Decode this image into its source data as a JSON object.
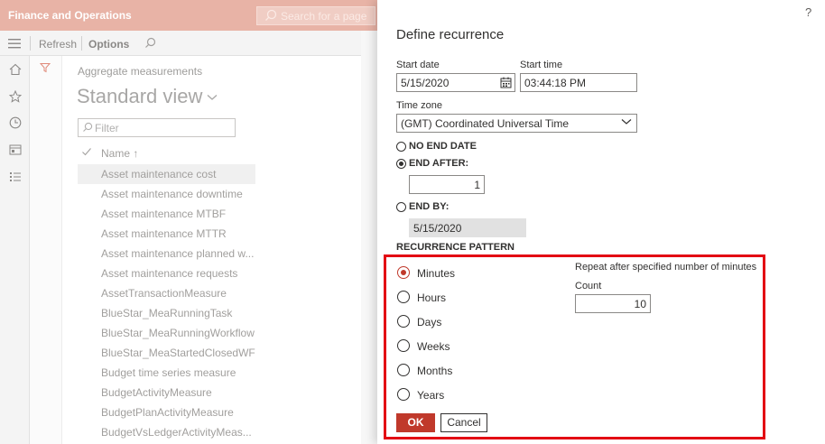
{
  "app": {
    "title": "Finance and Operations",
    "search_placeholder": "Search for a page"
  },
  "commandbar": {
    "refresh": "Refresh",
    "options": "Options"
  },
  "page": {
    "breadcrumb": "Aggregate measurements",
    "view_title": "Standard view",
    "filter_placeholder": "Filter",
    "column_name": "Name",
    "sort_indicator": "↑",
    "rows": [
      "Asset maintenance cost",
      "Asset maintenance downtime",
      "Asset maintenance MTBF",
      "Asset maintenance MTTR",
      "Asset maintenance planned w...",
      "Asset maintenance requests",
      "AssetTransactionMeasure",
      "BlueStar_MeaRunningTask",
      "BlueStar_MeaRunningWorkflow",
      "BlueStar_MeaStartedClosedWF",
      "Budget time series measure",
      "BudgetActivityMeasure",
      "BudgetPlanActivityMeasure",
      "BudgetVsLedgerActivityMeas..."
    ]
  },
  "dialog": {
    "help": "?",
    "title": "Define recurrence",
    "start_date_label": "Start date",
    "start_date_value": "5/15/2020",
    "start_time_label": "Start time",
    "start_time_value": "03:44:18 PM",
    "time_zone_label": "Time zone",
    "time_zone_value": "(GMT) Coordinated Universal Time",
    "no_end_date": "NO END DATE",
    "end_after": "END AFTER:",
    "end_after_value": "1",
    "end_by": "END BY:",
    "end_by_value": "5/15/2020",
    "recurrence_pattern": "RECURRENCE PATTERN",
    "patterns": [
      "Minutes",
      "Hours",
      "Days",
      "Weeks",
      "Months",
      "Years"
    ],
    "selected_pattern": "Minutes",
    "repeat_hint": "Repeat after specified number of minutes",
    "count_label": "Count",
    "count_value": "10",
    "ok": "OK",
    "cancel": "Cancel"
  },
  "colors": {
    "topbar": "#e8b3a6",
    "accent": "#c0392b",
    "highlight": "#e30613"
  }
}
